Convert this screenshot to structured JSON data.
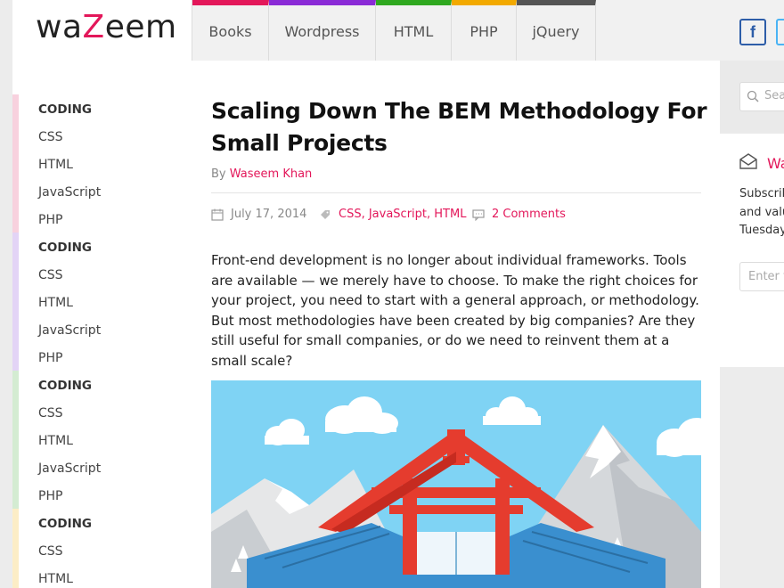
{
  "brand": {
    "prefix": "wa",
    "highlight": "Z",
    "suffix": "eem"
  },
  "nav": [
    {
      "label": "Books",
      "color": "#e3175a"
    },
    {
      "label": "Wordpress",
      "color": "#8a2ad6"
    },
    {
      "label": "HTML",
      "color": "#2fa81f"
    },
    {
      "label": "PHP",
      "color": "#f2a900"
    },
    {
      "label": "jQuery",
      "color": "#555555"
    }
  ],
  "social": {
    "facebook": "f"
  },
  "sidebar": [
    {
      "heading": "CODING",
      "color": "#f8d1de",
      "items": [
        "CSS",
        "HTML",
        "JavaScript",
        "PHP"
      ]
    },
    {
      "heading": "CODING",
      "color": "#e3d4f6",
      "items": [
        "CSS",
        "HTML",
        "JavaScript",
        "PHP"
      ]
    },
    {
      "heading": "CODING",
      "color": "#d4ecd2",
      "items": [
        "CSS",
        "HTML",
        "JavaScript",
        "PHP"
      ]
    },
    {
      "heading": "CODING",
      "color": "#fcedc6",
      "items": [
        "CSS",
        "HTML"
      ]
    }
  ],
  "post": {
    "title": "Scaling Down The BEM Methodology For Small Projects",
    "by_label": "By",
    "author": "Waseem Khan",
    "date": "July 17, 2014",
    "categories": "CSS, JavaScript, HTML",
    "comments": "2 Comments",
    "excerpt": "Front-end development is no longer about individual frameworks. Tools are available — we merely have to choose. To make the right choices for your project, you need to start with a general approach, or methodology. But most methodologies have been created by big companies? Are they still useful for small companies, or do we need to reinvent them at a small scale?"
  },
  "right": {
    "search_placeholder": "Sea",
    "newsletter_title": "Wa",
    "newsletter_text": [
      "Subscrib",
      "and valu",
      "Tuesday"
    ],
    "email_placeholder": "Enter y"
  },
  "colors": {
    "accent": "#e3175a"
  }
}
